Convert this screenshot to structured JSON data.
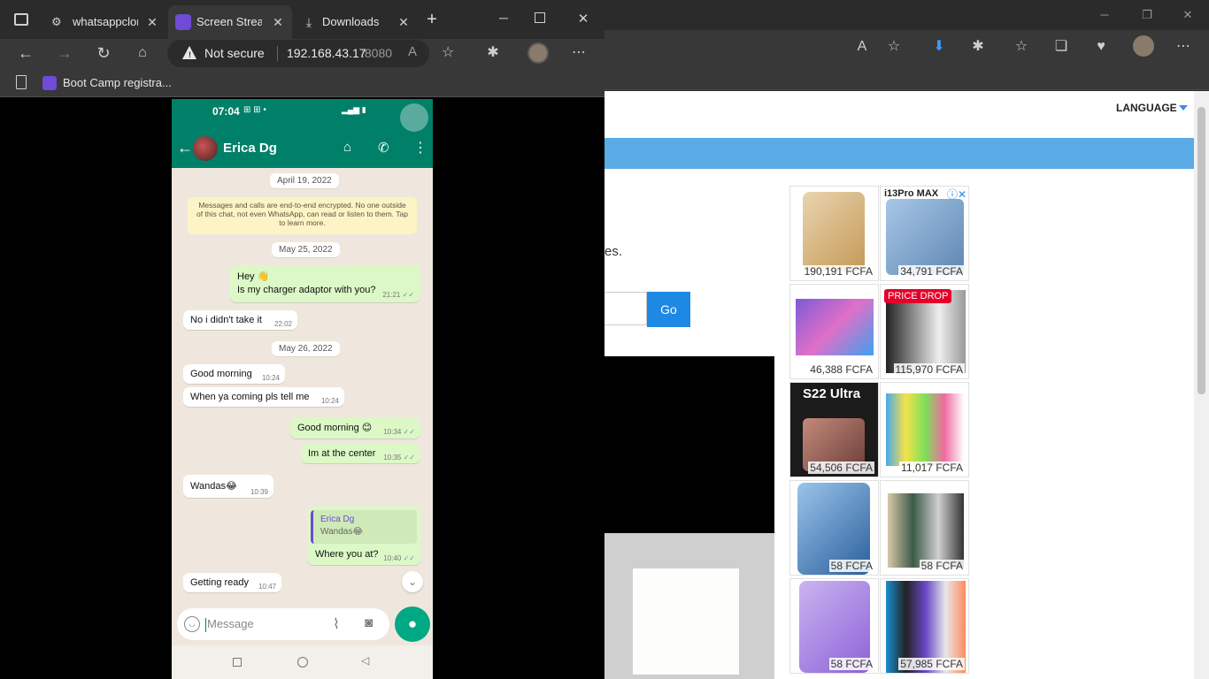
{
  "front_browser": {
    "tabs": [
      {
        "label": "whatsappclone",
        "active": false
      },
      {
        "label": "Screen Stream",
        "active": true
      },
      {
        "label": "Downloads",
        "active": false
      }
    ],
    "omnibox": {
      "security_label": "Not secure",
      "host": "192.168.43.17",
      "port": ":8080"
    },
    "bookmarks": [
      {
        "label": "Boot Camp registra..."
      }
    ]
  },
  "phone": {
    "status_time": "07:04",
    "contact_name": "Erica Dg",
    "dates": [
      "April 19, 2022",
      "May 25, 2022",
      "May 26, 2022"
    ],
    "encryption_notice": "Messages and calls are end-to-end encrypted. No one outside of this chat, not even WhatsApp, can read or listen to them. Tap to learn more.",
    "messages": [
      {
        "dir": "out",
        "text1": "Hey 👋",
        "text2": "Is my charger adaptor with you?",
        "time": "21:21"
      },
      {
        "dir": "in",
        "text": "No i didn't take it",
        "time": "22:02"
      },
      {
        "dir": "in",
        "text": "Good morning",
        "time": "10:24"
      },
      {
        "dir": "in",
        "text": "When ya coming pls tell me",
        "time": "10:24"
      },
      {
        "dir": "out",
        "text": "Good morning 😊",
        "time": "10:34"
      },
      {
        "dir": "out",
        "text": "Im at the center",
        "time": "10:35"
      },
      {
        "dir": "in",
        "text": "Wandas😂",
        "time": "10:39"
      },
      {
        "dir": "out",
        "quote_name": "Erica Dg",
        "quote_text": "Wandas😂",
        "text": "Where you at?",
        "time": "10:40"
      },
      {
        "dir": "in",
        "text": "Getting ready",
        "time": "10:47"
      }
    ],
    "input_placeholder": "Message"
  },
  "back_page": {
    "language_label": "LANGUAGE",
    "text_fragment": "es.",
    "go_button": "Go",
    "ads": [
      {
        "price": "190,191 FCFA",
        "badge": ""
      },
      {
        "price": "34,791 FCFA",
        "badge": "i13Pro MAX"
      },
      {
        "price": "46,388 FCFA",
        "badge": ""
      },
      {
        "price": "115,970 FCFA",
        "badge": "PRICE DROP"
      },
      {
        "price": "54,506 FCFA",
        "badge": "S22 Ultra"
      },
      {
        "price": "11,017 FCFA",
        "badge": ""
      },
      {
        "price": "58 FCFA",
        "badge": ""
      },
      {
        "price": "58 FCFA",
        "badge": ""
      },
      {
        "price": "58 FCFA",
        "badge": ""
      },
      {
        "price": "57,985 FCFA",
        "badge": ""
      }
    ]
  },
  "colors": {
    "whatsapp_green": "#008069",
    "outgoing_bubble": "#dcf8c6",
    "page_blue_bar": "#5aabe6",
    "go_button": "#1e88e5",
    "price_drop": "#e4002b"
  }
}
